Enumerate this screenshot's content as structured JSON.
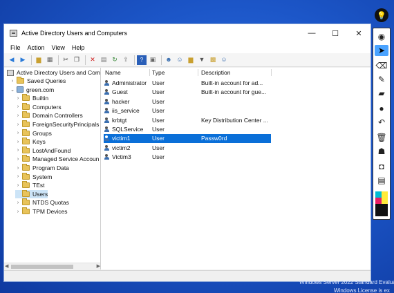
{
  "window": {
    "title": "Active Directory Users and Computers",
    "controls": {
      "minimize": "—",
      "maximize": "☐",
      "close": "✕"
    }
  },
  "menu": [
    "File",
    "Action",
    "View",
    "Help"
  ],
  "tree": {
    "root": "Active Directory Users and Com",
    "items": [
      {
        "label": "Saved Queries",
        "expander": "›",
        "icon": "folder-icon"
      },
      {
        "label": "green.com",
        "expander": "⌄",
        "icon": "domain-icon"
      },
      {
        "label": "Builtin",
        "expander": "›",
        "icon": "folder-icon"
      },
      {
        "label": "Computers",
        "expander": "›",
        "icon": "folder-icon"
      },
      {
        "label": "Domain Controllers",
        "expander": "›",
        "icon": "folder-icon"
      },
      {
        "label": "ForeignSecurityPrincipals",
        "expander": "›",
        "icon": "folder-icon"
      },
      {
        "label": "Groups",
        "expander": "›",
        "icon": "folder-icon"
      },
      {
        "label": "Keys",
        "expander": "›",
        "icon": "folder-icon"
      },
      {
        "label": "LostAndFound",
        "expander": "›",
        "icon": "folder-icon"
      },
      {
        "label": "Managed Service Accoun",
        "expander": "›",
        "icon": "folder-icon"
      },
      {
        "label": "Program Data",
        "expander": "›",
        "icon": "folder-icon"
      },
      {
        "label": "System",
        "expander": "›",
        "icon": "folder-icon"
      },
      {
        "label": "TEst",
        "expander": "›",
        "icon": "folder-icon"
      },
      {
        "label": "Users",
        "expander": "",
        "icon": "folder-icon",
        "selected": true
      },
      {
        "label": "NTDS Quotas",
        "expander": "›",
        "icon": "folder-icon"
      },
      {
        "label": "TPM Devices",
        "expander": "›",
        "icon": "folder-icon"
      }
    ]
  },
  "list": {
    "headers": {
      "name": "Name",
      "type": "Type",
      "description": "Description"
    },
    "rows": [
      {
        "name": "Administrator",
        "type": "User",
        "description": "Built-in account for ad..."
      },
      {
        "name": "Guest",
        "type": "User",
        "description": "Built-in account for gue..."
      },
      {
        "name": "hacker",
        "type": "User",
        "description": ""
      },
      {
        "name": "iis_service",
        "type": "User",
        "description": ""
      },
      {
        "name": "krbtgt",
        "type": "User",
        "description": "Key Distribution Center ..."
      },
      {
        "name": "SQLService",
        "type": "User",
        "description": ""
      },
      {
        "name": "victim1",
        "type": "User",
        "description": "Passw0rd",
        "selected": true
      },
      {
        "name": "victim2",
        "type": "User",
        "description": ""
      },
      {
        "name": "Victim3",
        "type": "User",
        "description": ""
      }
    ]
  },
  "os_watermark": {
    "line1": "Windows Server 2022 Standard Evalua",
    "line2": "Windows License is ex"
  },
  "annotation_tools": [
    "eye-icon",
    "pointer-icon",
    "eraser-icon",
    "pen-icon",
    "marker-icon",
    "dot-icon",
    "undo-icon",
    "trash-icon",
    "ghost-icon",
    "camera-icon",
    "clipboard-icon"
  ],
  "colors": {
    "selection": "#0a6fd8",
    "swatch_colors": [
      "#00bcd4",
      "#ffeb3b",
      "#e91e63",
      "#111111"
    ]
  }
}
